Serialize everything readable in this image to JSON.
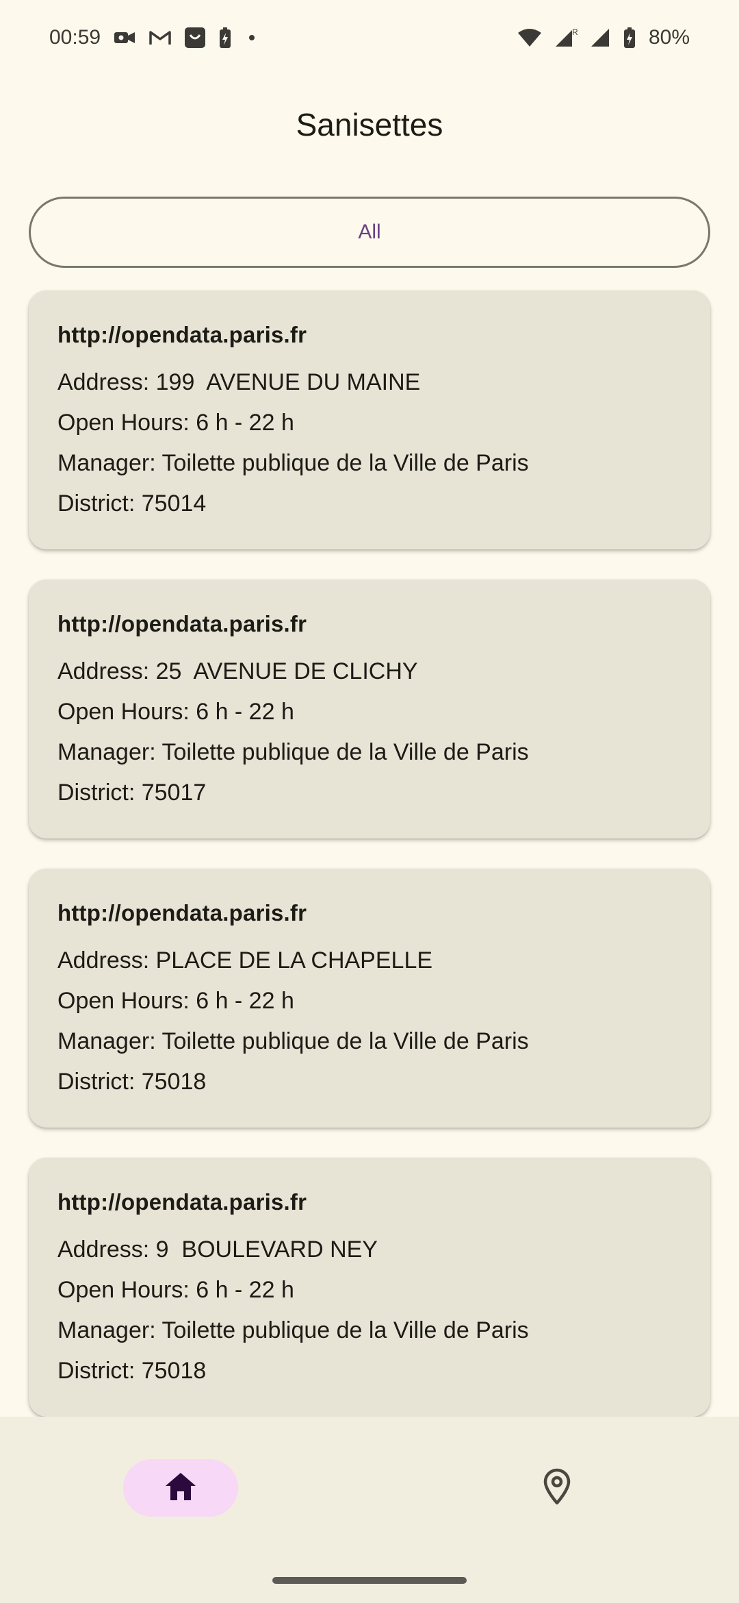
{
  "status_bar": {
    "time": "00:59",
    "battery": "80%",
    "left_icons": [
      "video-call-icon",
      "gmail-icon",
      "square-app-icon",
      "battery-saver-icon",
      "dot-icon"
    ],
    "right_icons": [
      "wifi-icon",
      "signal-roaming-icon",
      "signal-icon",
      "battery-charging-icon"
    ],
    "roaming_label": "R"
  },
  "header": {
    "title": "Sanisettes"
  },
  "filter": {
    "label": "All"
  },
  "cards": [
    {
      "source": "http://opendata.paris.fr",
      "address": "Address: 199  AVENUE DU MAINE",
      "hours": "Open Hours: 6 h - 22 h",
      "manager": "Manager: Toilette publique de la Ville de Paris",
      "district": "District: 75014"
    },
    {
      "source": "http://opendata.paris.fr",
      "address": "Address: 25  AVENUE DE CLICHY",
      "hours": "Open Hours: 6 h - 22 h",
      "manager": "Manager: Toilette publique de la Ville de Paris",
      "district": "District: 75017"
    },
    {
      "source": "http://opendata.paris.fr",
      "address": "Address: PLACE DE LA CHAPELLE",
      "hours": "Open Hours: 6 h - 22 h",
      "manager": "Manager: Toilette publique de la Ville de Paris",
      "district": "District: 75018"
    },
    {
      "source": "http://opendata.paris.fr",
      "address": "Address: 9  BOULEVARD NEY",
      "hours": "Open Hours: 6 h - 22 h",
      "manager": "Manager: Toilette publique de la Ville de Paris",
      "district": "District: 75018"
    }
  ],
  "bottom_nav": {
    "items": [
      {
        "icon": "home-icon",
        "selected": true
      },
      {
        "icon": "map-pin-icon",
        "selected": false
      }
    ]
  },
  "colors": {
    "background": "#FDF9EC",
    "card": "#E7E4D5",
    "accent": "#6A3F86",
    "nav_selected": "#F7D8F6",
    "nav_background": "#F2EEDF"
  }
}
